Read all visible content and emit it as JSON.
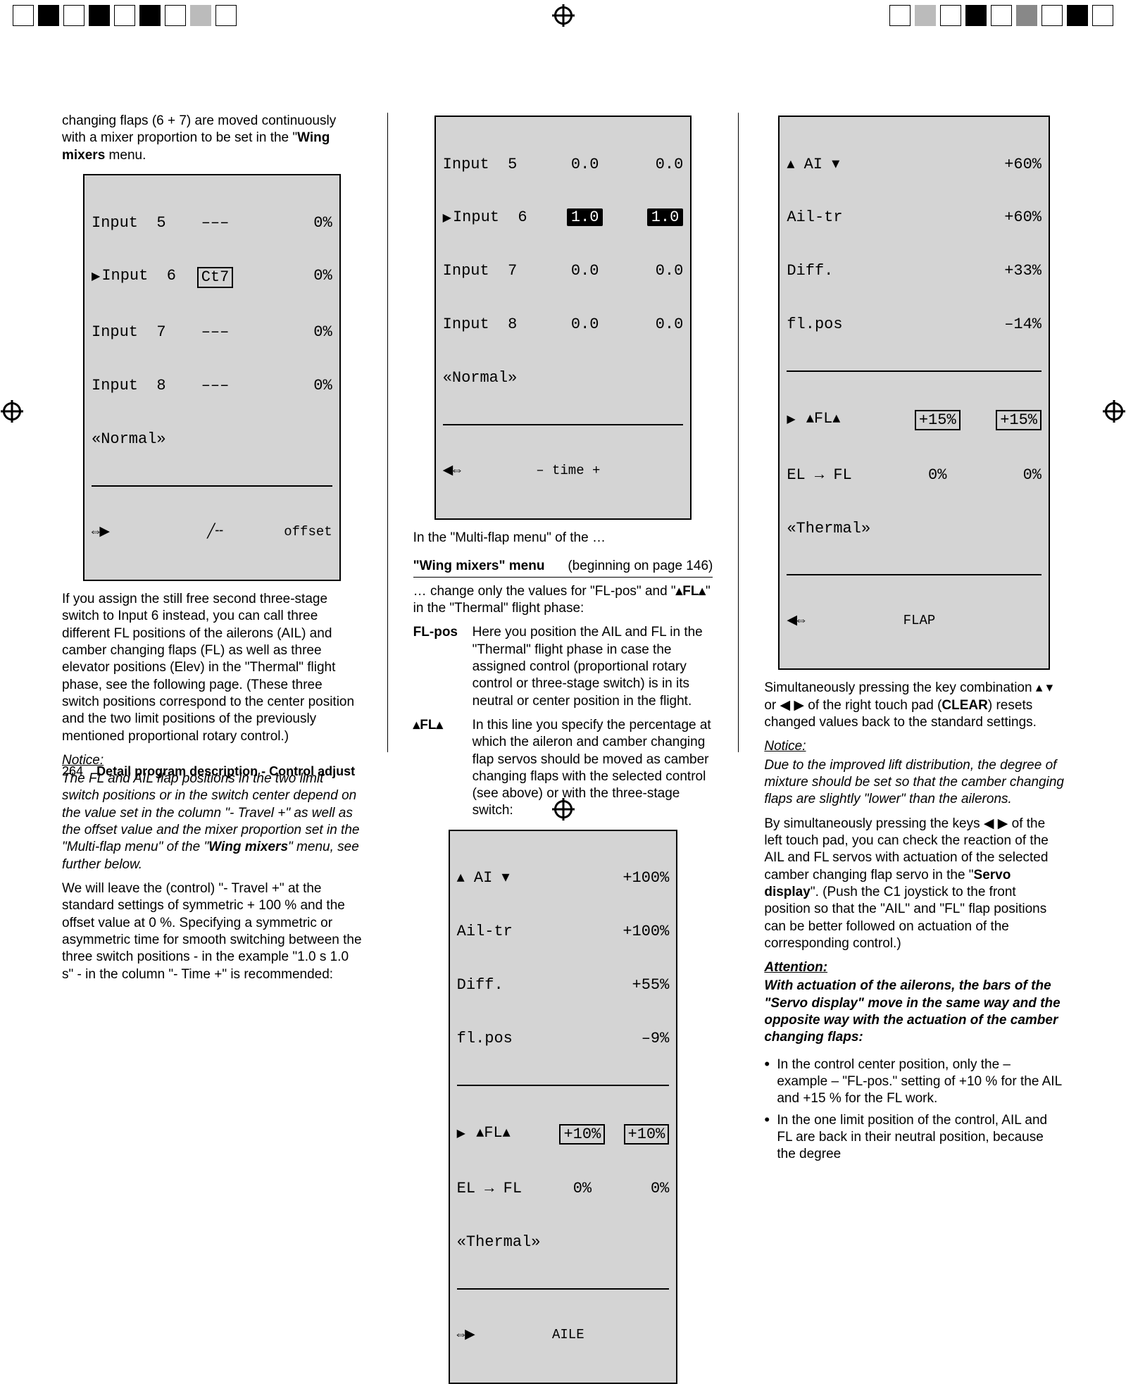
{
  "col1": {
    "p1a": "changing flaps (6 + 7) are moved continuously with a mixer proportion to be set in the \"",
    "p1b": "Wing mixers",
    "p1c": " menu.",
    "lcd1": {
      "r1a": "Input  5",
      "r1b": "–––",
      "r1c": "0%",
      "r2a": "Input  6",
      "r2b": "Ct7",
      "r2c": "0%",
      "r3a": "Input  7",
      "r3b": "–––",
      "r3c": "0%",
      "r4a": "Input  8",
      "r4b": "–––",
      "r4c": "0%",
      "mode": "Normal",
      "fa": "⇔▶",
      "fb": "╱╌",
      "fc": "offset"
    },
    "p2": "If you assign the still free second three-stage switch to Input 6 instead, you can call three different FL positions of the ailerons (AIL) and camber changing flaps (FL) as well as three elevator positions (Elev) in the \"Thermal\" flight phase, see the following page. (These three switch positions correspond to the center position and the two limit positions of the previously mentioned proportional rotary control.)",
    "noticeLabel": "Notice:",
    "p3": "The FL and AIL flap positions in the two limit switch positions or in the switch center depend on the value set in the column \"- Travel +\" as well as the offset value and the mixer proportion set in the \"Multi-flap menu\" of the \"",
    "p3b": "Wing mixers",
    "p3c": "\" menu, see further below.",
    "p4": "We will leave the (control) \"- Travel +\" at the standard settings of symmetric + 100 % and the offset value at 0 %. Specifying a symmetric or asymmetric time for smooth switching between the three switch positions - in the example \"1.0 s 1.0 s\" - in the column \"- Time +\" is recommended:"
  },
  "col2": {
    "lcd2": {
      "r1a": "Input  5",
      "r1b": "0.0",
      "r1c": "0.0",
      "r2a": "Input  6",
      "r2b": "1.0",
      "r2c": "1.0",
      "r3a": "Input  7",
      "r3b": "0.0",
      "r3c": "0.0",
      "r4a": "Input  8",
      "r4b": "0.0",
      "r4c": "0.0",
      "mode": "Normal",
      "fa": "◀⇔",
      "fb": "– time +"
    },
    "p1": "In the \"Multi-flap menu\" of the …",
    "menuA": "\"Wing mixers\" menu",
    "menuB": "(beginning on page 146)",
    "p2a": "… change only the values for \"FL-pos\" and \"",
    "p2b": "▴FL▴",
    "p2c": "\" in the \"Thermal\" flight phase:",
    "def1t": "FL-pos",
    "def1d": "Here you position the AIL and FL in the \"Thermal\" flight phase in case the assigned control (proportional rotary control or three-stage switch) is in its neutral or center position in the flight.",
    "def2t": "▴FL▴",
    "def2d": "In this line you specify the percentage at which the aileron and camber changing flap servos should be moved as camber changing flaps with the selected control (see above) or with the three-stage switch:",
    "lcd3": {
      "r1a": "▴ AI ▾",
      "r1b": "+100%",
      "r2a": "Ail-tr",
      "r2b": "+100%",
      "r3a": "Diff.",
      "r3b": "+55%",
      "r4a": "fl.pos",
      "r4b": "–9%",
      "r5a": "▴FL▴",
      "r5b": "+10%",
      "r5c": "+10%",
      "r6a": "EL → FL",
      "r6b": "0%",
      "r6c": "0%",
      "mode": "Thermal",
      "fa": "⇔▶",
      "fb": "AILE"
    }
  },
  "col3": {
    "lcd4": {
      "r1a": "▴ AI ▾",
      "r1b": "+60%",
      "r2a": "Ail-tr",
      "r2b": "+60%",
      "r3a": "Diff.",
      "r3b": "+33%",
      "r4a": "fl.pos",
      "r4b": "–14%",
      "r5a": "▴FL▴",
      "r5b": "+15%",
      "r5c": "+15%",
      "r6a": "EL → FL",
      "r6b": "0%",
      "r6c": "0%",
      "mode": "Thermal",
      "fa": "◀⇔",
      "fb": "FLAP"
    },
    "p1a": "Simultaneously pressing the key combination ▴ ▾ or ◀ ▶ of the right touch pad (",
    "p1b": "CLEAR",
    "p1c": ") resets changed values back to the standard settings.",
    "noticeLabel": "Notice:",
    "p2": "Due to the improved lift distribution, the degree of mixture should be set so that the camber changing flaps are slightly \"lower\" than the ailerons.",
    "p3a": "By simultaneously pressing the keys ◀ ▶ of the left touch pad, you can check the reaction of the AIL and FL servos with actuation of the selected camber changing flap servo in the \"",
    "p3b": "Servo display",
    "p3c": "\". (Push the C1 joystick to the front position so that the \"AIL\" and \"FL\" flap positions can be better followed on actuation of the corresponding control.)",
    "attnLabel": "Attention:",
    "p4": "With actuation of the ailerons, the bars of the \"Servo display\" move in the same way and the opposite way with the actuation of the camber changing flaps:",
    "li1": "In the control center position, only the  – example – \"FL-pos.\" setting of +10 % for the AIL and +15 % for the FL work.",
    "li2": "In the one limit position of the control, AIL and FL are back in their neutral position, because the degree"
  },
  "footer": {
    "page": "264",
    "title": "Detail program description - Control adjust"
  }
}
